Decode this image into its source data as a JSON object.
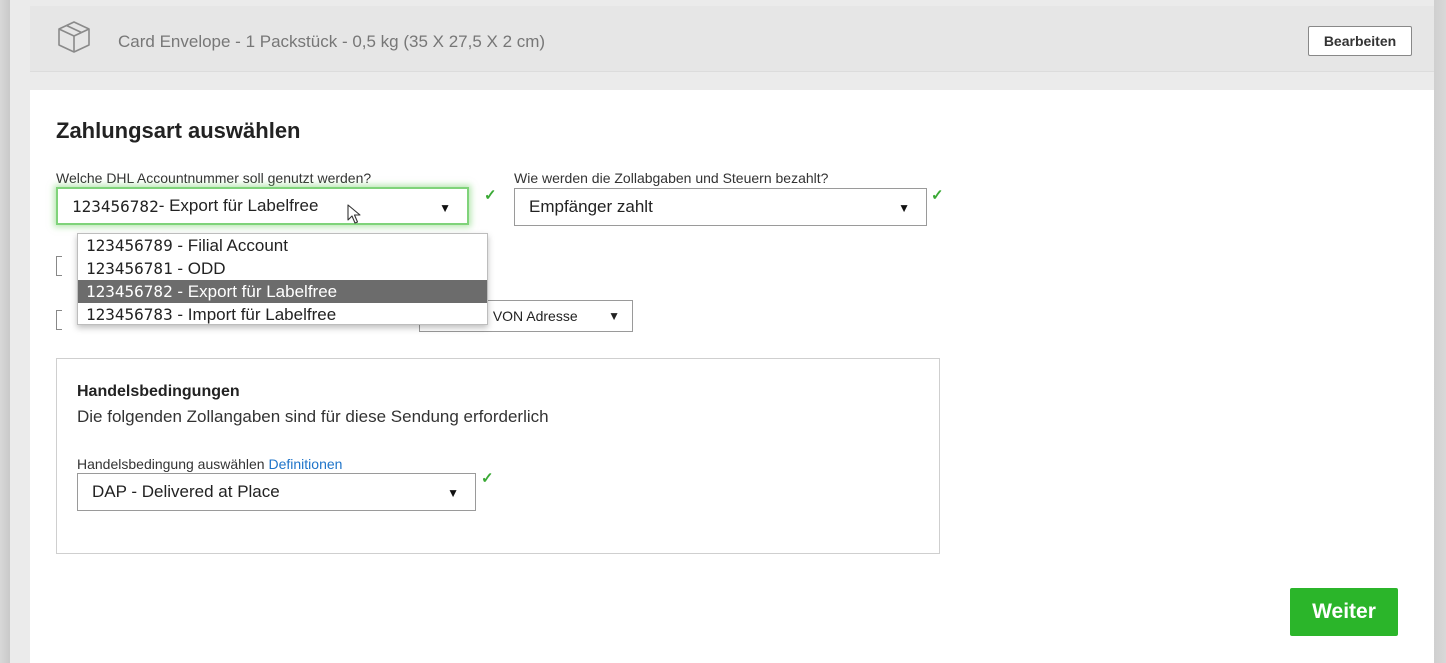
{
  "package": {
    "icon": "package-box-icon",
    "summary": "Card Envelope - 1 Packstück - 0,5 kg (35 X 27,5 X 2 cm)",
    "edit_label": "Bearbeiten"
  },
  "payment": {
    "title": "Zahlungsart auswählen",
    "account": {
      "label": "Welche DHL Accountnummer soll genutzt werden?",
      "selected_number": "123456782",
      "selected_name": "- Export für Labelfree",
      "options": [
        {
          "number": "123456789",
          "name": " - Filial Account"
        },
        {
          "number": "123456781",
          "name": " - ODD"
        },
        {
          "number": "123456782",
          "name": " - Export für Labelfree"
        },
        {
          "number": "123456783",
          "name": " - Import für Labelfree"
        }
      ]
    },
    "duties": {
      "label": "Wie werden die Zollabgaben und Steuern bezahlt?",
      "selected": "Empfänger zahlt"
    },
    "address_select": "enden VON Adresse",
    "check_glyph": "✓",
    "arrow_glyph": "▼"
  },
  "terms": {
    "heading": "Handelsbedingungen",
    "subtitle": "Die folgenden Zollangaben sind für diese Sendung erforderlich",
    "select_label": "Handelsbedingung auswählen",
    "definitions_link": "Definitionen",
    "selected": "DAP - Delivered at Place"
  },
  "actions": {
    "next_label": "Weiter"
  },
  "colors": {
    "accent_green": "#2bb52a",
    "check_green": "#3aa935",
    "link_blue": "#1f74c9",
    "selected_option": "#6c6c6c"
  }
}
